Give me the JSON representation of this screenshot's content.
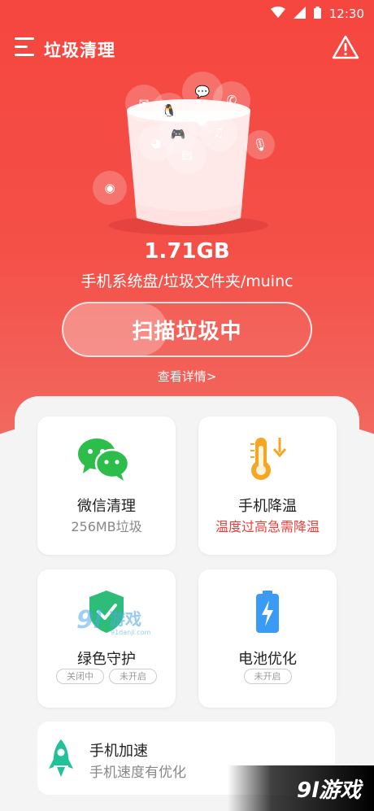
{
  "status_bar": {
    "time": "12:30"
  },
  "header": {
    "title": "垃圾清理"
  },
  "scan": {
    "size": "1.71GB",
    "path": "手机系统盘/垃圾文件夹/muinc",
    "button_label": "扫描垃圾中",
    "progress_fraction": 0.42,
    "details_link": "查看详情>"
  },
  "cards": {
    "wechat": {
      "title": "微信清理",
      "sub": "256MB垃圾"
    },
    "cooling": {
      "title": "手机降温",
      "sub": "温度过高急需降温"
    },
    "guard": {
      "title": "绿色守护",
      "pill1": "关闭中",
      "pill2": "未开启"
    },
    "battery": {
      "title": "电池优化",
      "pill1": "未开启"
    },
    "speed": {
      "title": "手机加速",
      "sub": "手机速度有优化"
    }
  },
  "watermark": {
    "center": "游戏",
    "center_sub": "91danji.com",
    "corner": "9l游戏"
  },
  "colors": {
    "primary_red": "#f5463f",
    "wechat_green": "#2dbd4a",
    "temp_orange": "#f5a623",
    "battery_blue": "#3a9bf5",
    "rocket_green": "#21c29a"
  }
}
